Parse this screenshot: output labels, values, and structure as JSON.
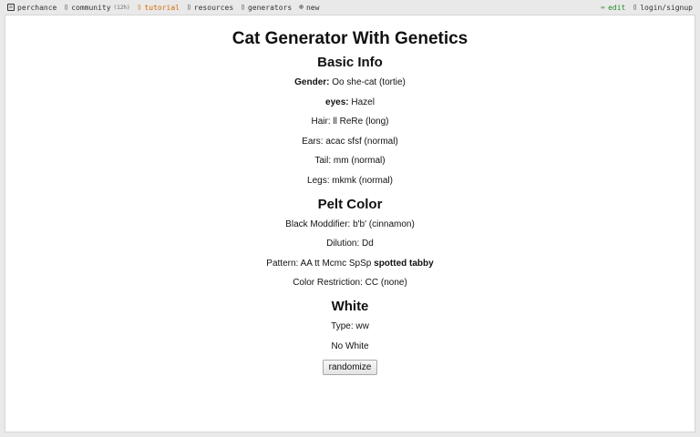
{
  "nav": {
    "perchance": "perchance",
    "community": "community",
    "community_count": "(12h)",
    "tutorial": "tutorial",
    "resources": "resources",
    "generators": "generators",
    "new": "new",
    "edit": "edit",
    "login": "login/signup"
  },
  "page": {
    "title": "Cat Generator With Genetics",
    "basic_info": {
      "heading": "Basic Info",
      "gender_label": "Gender:",
      "gender_value": "Oo she-cat (tortie)",
      "eyes_label": "eyes:",
      "eyes_value": "Hazel",
      "hair": "Hair: ll ReRe (long)",
      "ears": "Ears: acac sfsf (normal)",
      "tail": "Tail: mm (normal)",
      "legs": "Legs: mkmk (normal)"
    },
    "pelt_color": {
      "heading": "Pelt Color",
      "black_modifier": "Black Moddifier: b'b' (cinnamon)",
      "dilution": "Dilution: Dd",
      "pattern_prefix": "Pattern: AA tt Mcmc SpSp",
      "pattern_bold": "spotted tabby",
      "color_restriction": "Color Restriction: CC (none)"
    },
    "white": {
      "heading": "White",
      "type": "Type: ww",
      "result": "No White"
    },
    "randomize_label": "randomize"
  }
}
